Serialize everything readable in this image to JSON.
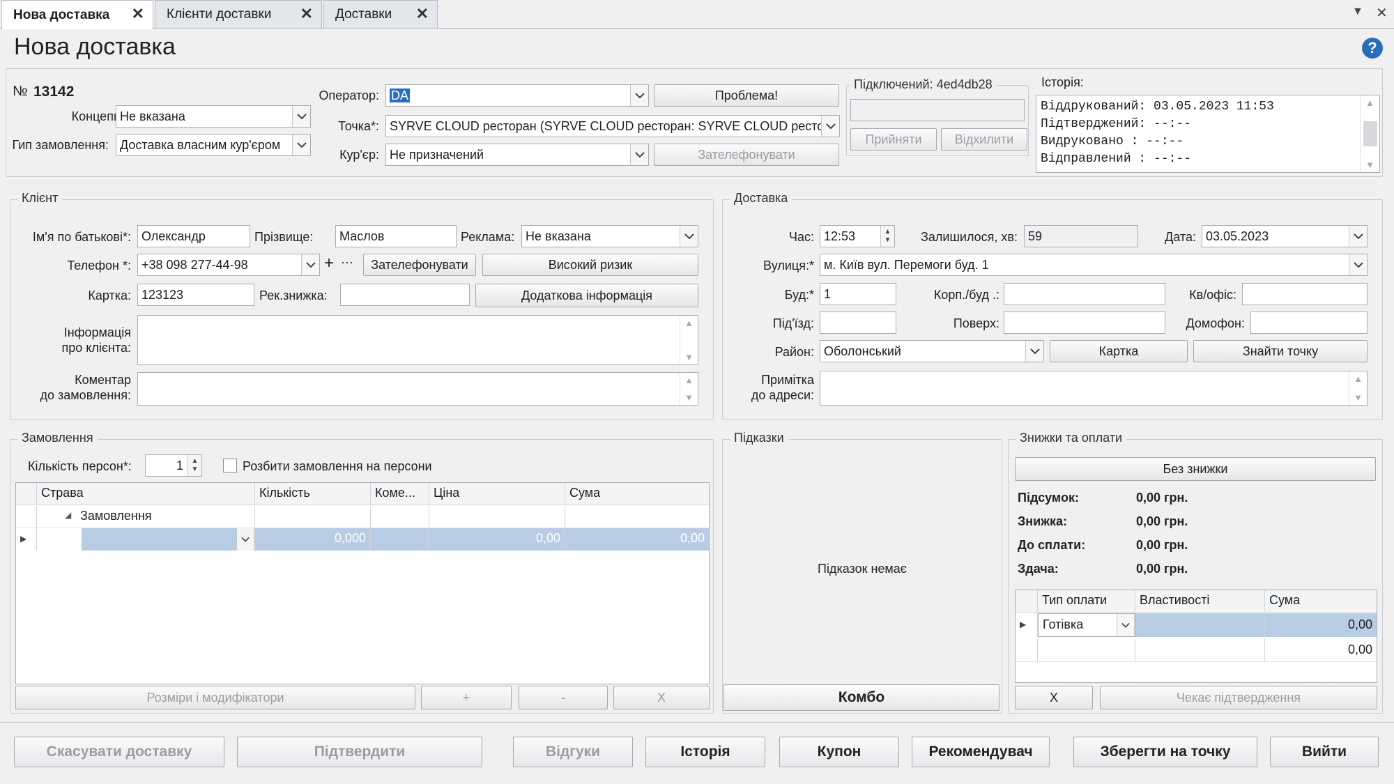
{
  "tabs": [
    {
      "label": "Нова доставка"
    },
    {
      "label": "Клієнти доставки"
    },
    {
      "label": "Доставки"
    }
  ],
  "title": "Нова доставка",
  "header": {
    "number_prefix": "№",
    "number": "13142",
    "concept_label": "Концепція:",
    "concept_value": "Не вказана",
    "order_type_label": "Гип замовлення:",
    "order_type_value": "Доставка власним кур'єром",
    "operator_label": "Оператор:",
    "operator_value": "DA",
    "point_label": "Точка*:",
    "point_value": "SYRVE CLOUD ресторан (SYRVE CLOUD ресторан: SYRVE CLOUD ресто...",
    "courier_label": "Кур'єр:",
    "courier_value": "Не призначений",
    "problem_btn": "Проблема!",
    "call_btn": "Зателефонувати",
    "connected_label": "Підключений: 4ed4db28",
    "accept_btn": "Прийняти",
    "reject_btn": "Відхилити",
    "history_label": "Історія:",
    "history_lines": [
      "Віддрукований: 03.05.2023 11:53",
      "Підтверджений: --:--",
      "Видруковано   : --:--",
      "Відправлений   : --:--"
    ]
  },
  "client": {
    "legend": "Клієнт",
    "name_label": "Ім'я по батькові*:",
    "name_value": "Олександр",
    "surname_label": "Прізвище:",
    "surname_value": "Маслов",
    "ads_label": "Реклама:",
    "ads_value": "Не вказана",
    "phone_label": "Телефон *:",
    "phone_value": "+38 098 277-44-98",
    "plus": "+",
    "more": "···",
    "call_btn": "Зателефонувати",
    "high_risk_btn": "Високий ризик",
    "card_label": "Картка:",
    "card_value": "123123",
    "discount_label": "Рек.знижка:",
    "discount_value": "",
    "extra_info_btn": "Додаткова інформація",
    "info_label_1": "Інформація",
    "info_label_2": "про клієнта:",
    "comment_label_1": "Коментар",
    "comment_label_2": "до замовлення:"
  },
  "delivery": {
    "legend": "Доставка",
    "time_label": "Час:",
    "time_value": "12:53",
    "left_label": "Залишилося, хв:",
    "left_value": "59",
    "date_label": "Дата:",
    "date_value": "03.05.2023",
    "street_label": "Вулиця:*",
    "street_value": "м. Київ вул. Перемоги буд. 1",
    "house_label": "Буд:*",
    "house_value": "1",
    "building_label": "Корп./буд .:",
    "building_value": "",
    "apt_label": "Кв/офіс:",
    "apt_value": "",
    "entrance_label": "Під'їзд:",
    "entrance_value": "",
    "floor_label": "Поверх:",
    "floor_value": "",
    "intercom_label": "Домофон:",
    "intercom_value": "",
    "district_label": "Район:",
    "district_value": "Оболонський",
    "map_btn": "Картка",
    "find_point_btn": "Знайти точку",
    "note_label_1": "Примітка",
    "note_label_2": "до адреси:"
  },
  "order": {
    "legend": "Замовлення",
    "persons_label": "Кількість персон*:",
    "persons_value": "1",
    "split_label": "Розбити замовлення на персони",
    "columns": [
      "Страва",
      "Кількість",
      "Коме...",
      "Ціна",
      "Сума"
    ],
    "group_row": "Замовлення",
    "row": {
      "qty": "0,000",
      "price": "0,00",
      "sum": "0,00"
    },
    "mods_btn": "Розміри і модифікатори",
    "plus_btn": "+",
    "minus_btn": "-",
    "x_btn": "X"
  },
  "hints": {
    "legend": "Підказки",
    "empty": "Підказок немає",
    "combo_btn": "Комбо"
  },
  "payments": {
    "legend": "Знижки та оплати",
    "no_discount_btn": "Без знижки",
    "totals": [
      {
        "label": "Підсумок:",
        "value": "0,00 грн."
      },
      {
        "label": "Знижка:",
        "value": "0,00 грн."
      },
      {
        "label": "До сплати:",
        "value": "0,00 грн."
      },
      {
        "label": "Здача:",
        "value": "0,00 грн."
      }
    ],
    "columns": [
      "Тип оплати",
      "Властивості",
      "Сума"
    ],
    "row1": {
      "type": "Готівка",
      "sum": "0,00"
    },
    "row2": {
      "sum": "0,00"
    },
    "x_btn": "X",
    "waiting_btn": "Чекає підтвердження"
  },
  "footer": {
    "cancel": "Скасувати доставку",
    "confirm": "Підтвердити",
    "reviews": "Відгуки",
    "history": "Історія",
    "coupon": "Купон",
    "recommender": "Рекомендувач",
    "save": "Зберегти на точку",
    "exit": "Вийти"
  },
  "colors": {
    "selection": "#b8cce4",
    "accent": "#2a6ebb"
  }
}
